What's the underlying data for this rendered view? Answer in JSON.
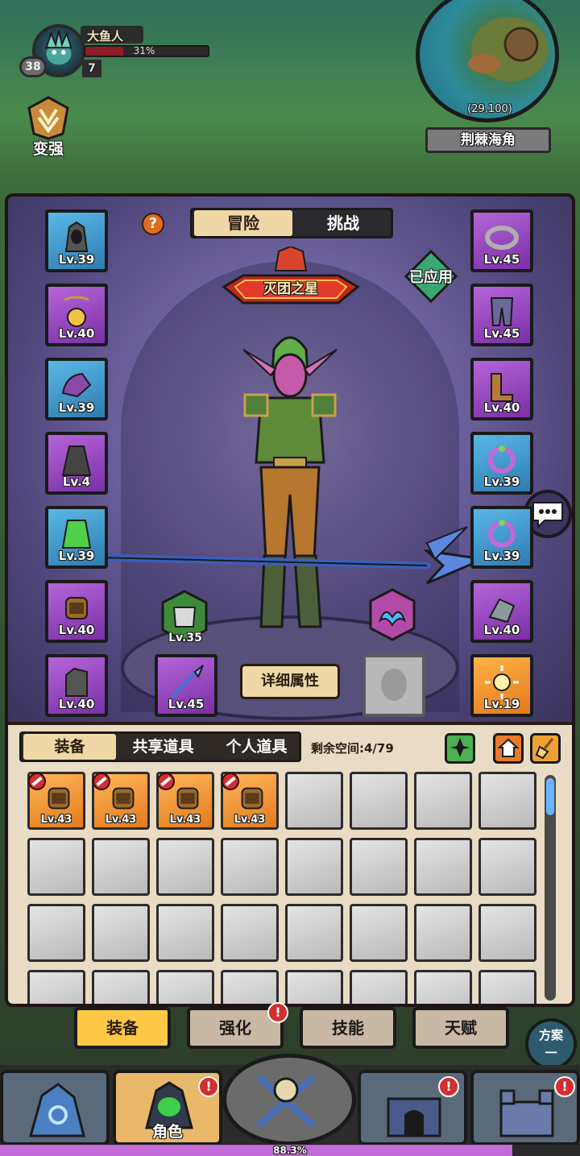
{
  "hud": {
    "player_name": "大鱼人",
    "hp_percent": 31,
    "hp_text": "31%",
    "level": "38",
    "rank": "7"
  },
  "grow_button": {
    "label": "变强"
  },
  "minimap": {
    "coords": "(29,100)",
    "location": "荆棘海角"
  },
  "character": {
    "tabs": [
      "冒险",
      "挑战"
    ],
    "active_tab": "冒险",
    "help_symbol": "?",
    "title": "灭团之星",
    "applied_label": "已应用",
    "detail_button": "详细属性",
    "armor_badge_lv": "Lv.35",
    "left_slots": [
      {
        "lv": "Lv.39",
        "rarity": "blue",
        "icon": "hood-icon"
      },
      {
        "lv": "Lv.40",
        "rarity": "purple",
        "icon": "amulet-icon"
      },
      {
        "lv": "Lv.39",
        "rarity": "blue",
        "icon": "shoulder-icon"
      },
      {
        "lv": "Lv.4",
        "rarity": "purple",
        "icon": "robe-icon"
      },
      {
        "lv": "Lv.39",
        "rarity": "blue",
        "icon": "cloak-icon"
      },
      {
        "lv": "Lv.40",
        "rarity": "purple",
        "icon": "bracer-icon"
      },
      {
        "lv": "Lv.40",
        "rarity": "purple",
        "icon": "gauntlet-icon"
      }
    ],
    "weapon_slot": {
      "lv": "Lv.45",
      "rarity": "purple",
      "icon": "spear-icon"
    },
    "right_slots": [
      {
        "lv": "Lv.45",
        "rarity": "purple",
        "icon": "belt-icon"
      },
      {
        "lv": "Lv.45",
        "rarity": "purple",
        "icon": "pants-icon"
      },
      {
        "lv": "Lv.40",
        "rarity": "purple",
        "icon": "boots-icon"
      },
      {
        "lv": "Lv.39",
        "rarity": "blue",
        "icon": "ring-icon"
      },
      {
        "lv": "Lv.39",
        "rarity": "blue",
        "icon": "ring-icon"
      },
      {
        "lv": "Lv.40",
        "rarity": "purple",
        "icon": "trinket-icon"
      },
      {
        "lv": "Lv.19",
        "rarity": "orange",
        "icon": "sun-relic-icon"
      }
    ]
  },
  "inventory": {
    "tabs": [
      "装备",
      "共享道具",
      "个人道具"
    ],
    "active_tab": "装备",
    "space_text": "剩余空间:4/79",
    "items": [
      {
        "lv": "Lv.43",
        "rarity": "orange",
        "icon": "bracer-icon",
        "banned": true
      },
      {
        "lv": "Lv.43",
        "rarity": "orange",
        "icon": "bracer-icon",
        "banned": true
      },
      {
        "lv": "Lv.43",
        "rarity": "orange",
        "icon": "bracer-icon",
        "banned": true
      },
      {
        "lv": "Lv.43",
        "rarity": "orange",
        "icon": "bracer-icon",
        "banned": true
      }
    ],
    "colors": {
      "orange": "#e37a1c",
      "blue": "#2e7cb0",
      "purple": "#7a2fa6"
    }
  },
  "subtabs": {
    "items": [
      "装备",
      "强化",
      "技能",
      "天赋"
    ],
    "active": "装备",
    "alert_symbol": "!",
    "plan_label_top": "方案",
    "plan_label_bottom": "一"
  },
  "bottom_nav": {
    "role_label": "角色",
    "alert_symbol": "!"
  },
  "progress": {
    "percent": 88.3,
    "text": "88.3%"
  }
}
